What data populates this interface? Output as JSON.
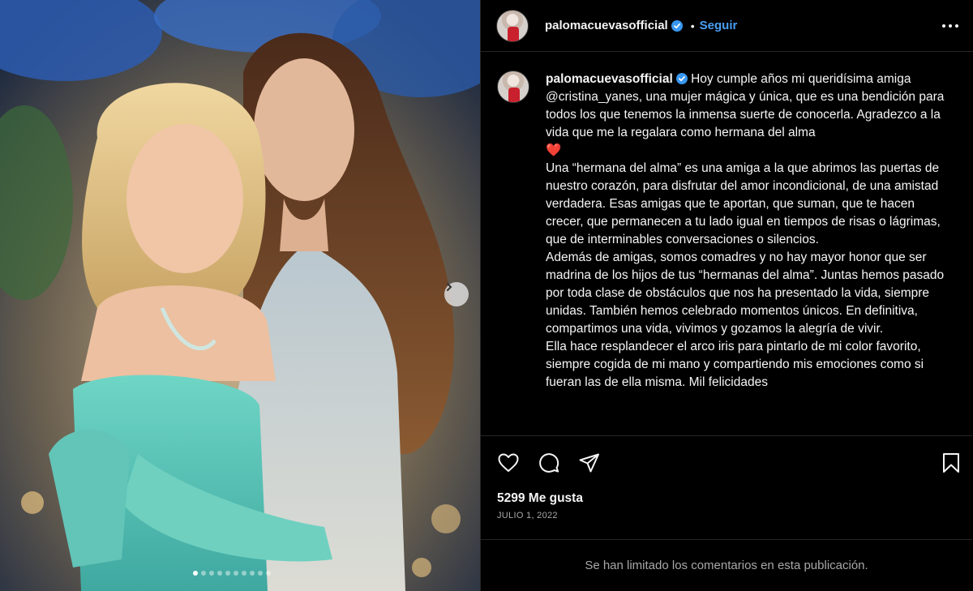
{
  "post": {
    "username": "palomacuevasofficial",
    "follow_label": "Seguir",
    "separator": "•",
    "caption_paragraphs": [
      "Hoy cumple años mi queridísima amiga @cristina_yanes, una mujer mágica y única, que es una bendición para todos los que tenemos la inmensa suerte de conocerla. Agradezco a la vida que me la regalara como hermana del alma",
      "❤️",
      "Una “hermana del alma” es una amiga a la que abrimos las puertas de nuestro corazón, para disfrutar del amor incondicional, de una amistad verdadera. Esas amigas que te aportan, que suman, que te hacen crecer, que permanecen a tu lado igual en tiempos de risas o lágrimas, que de interminables conversaciones o silencios.",
      "Además de amigas, somos comadres y no hay mayor honor que ser madrina de los hijos de tus “hermanas del alma”. Juntas hemos pasado por toda clase de obstáculos que nos ha presentado la vida, siempre unidas. También hemos celebrado momentos únicos. En definitiva, compartimos una vida, vivimos y gozamos la alegría de vivir.",
      "Ella hace resplandecer el arco iris para pintarlo de mi color favorito, siempre cogida de mi mano y compartiendo mis emociones como si fueran las de ella misma. Mil felicidades"
    ],
    "likes": "5299 Me gusta",
    "date": "JULIO 1, 2022",
    "comments_limited": "Se han limitado los comentarios en esta publicación.",
    "carousel": {
      "total": 10,
      "active_index": 0
    }
  },
  "icons": {
    "verified": "verified-badge-icon",
    "more": "more-options-icon",
    "like": "heart-icon",
    "comment": "comment-icon",
    "share": "share-icon",
    "save": "bookmark-icon",
    "next": "chevron-right-icon"
  },
  "colors": {
    "background": "#000000",
    "link": "#4a9ff5",
    "verified": "#3897f0",
    "muted": "#a8a8a8",
    "heart": "#e0245e"
  }
}
